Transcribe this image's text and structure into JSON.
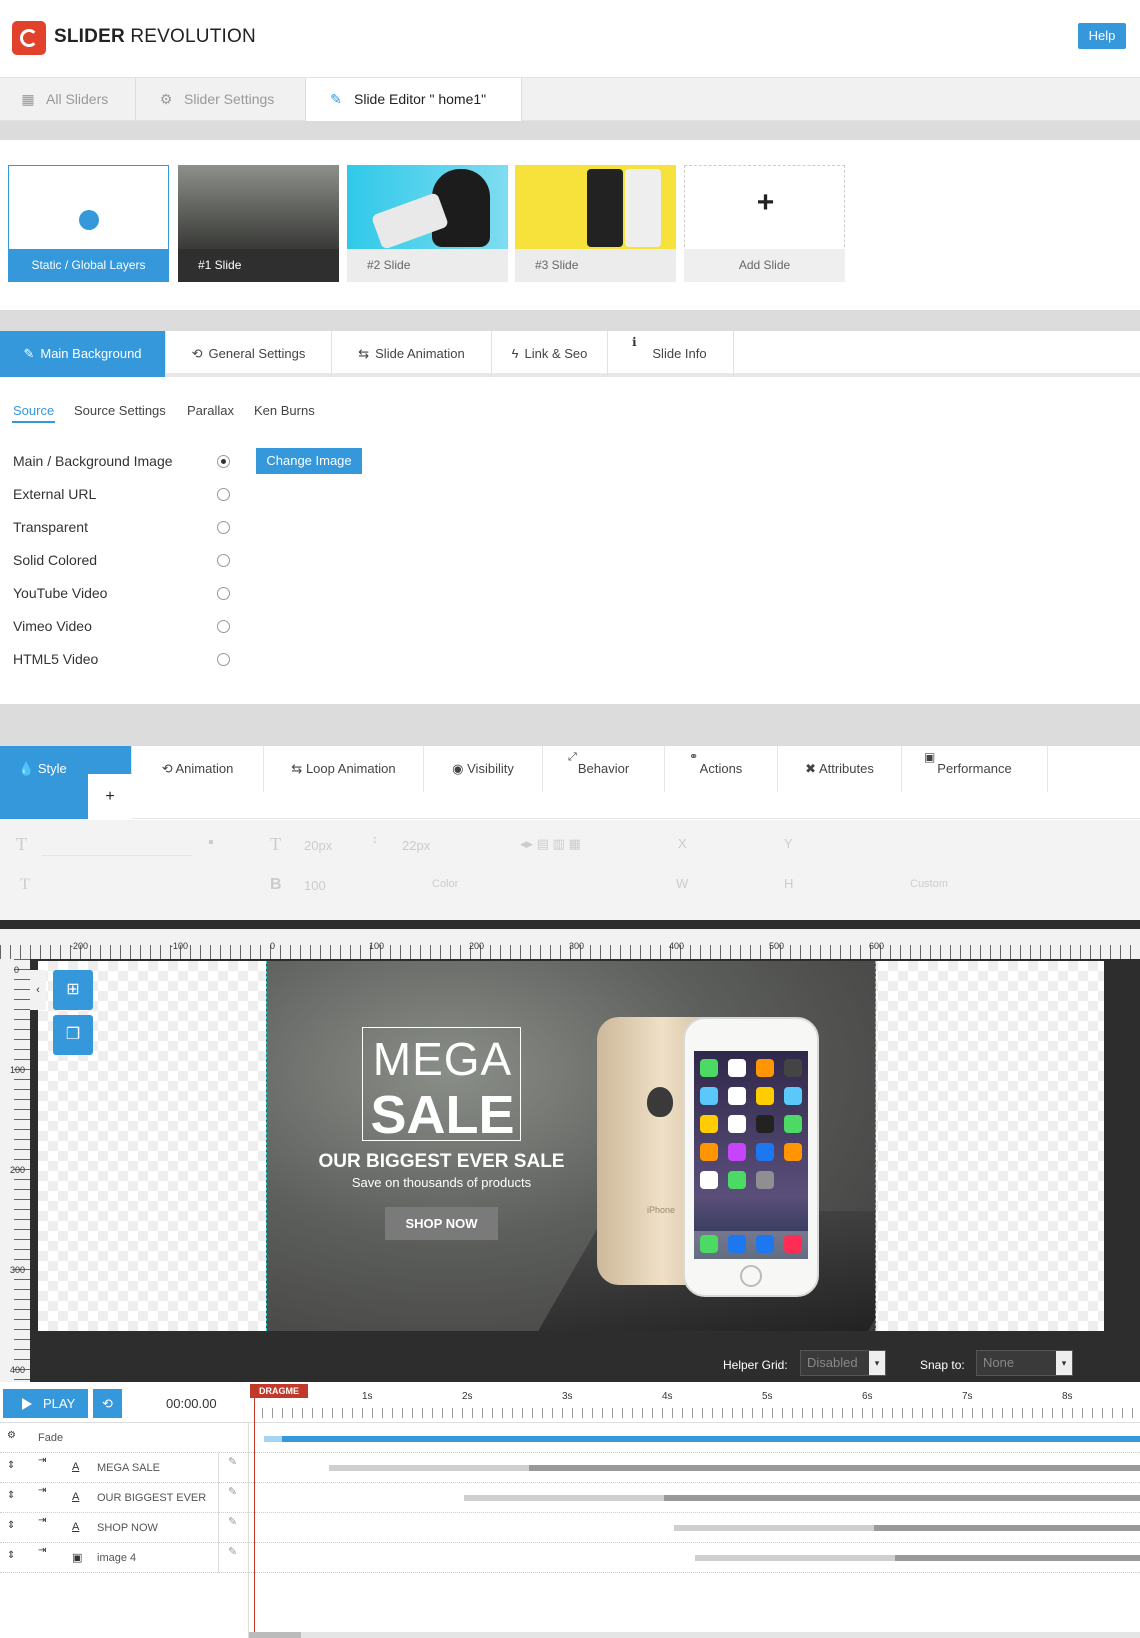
{
  "app": {
    "logo_bold": "SLIDER",
    "logo_rest": " REVOLUTION",
    "help": "Help"
  },
  "main_tabs": [
    {
      "label": "All Sliders",
      "icon": "grid-icon"
    },
    {
      "label": "Slider Settings",
      "icon": "gear-icon"
    },
    {
      "label": "Slide Editor \" home1\"",
      "icon": "pencil-icon"
    }
  ],
  "slides": [
    {
      "label": "Static / Global Layers"
    },
    {
      "label": "#1 Slide"
    },
    {
      "label": "#2 Slide"
    },
    {
      "label": "#3 Slide"
    },
    {
      "label": "Add Slide"
    }
  ],
  "slide_tabs": [
    "Main Background",
    "General Settings",
    "Slide Animation",
    "Link & Seo",
    "Slide Info"
  ],
  "sub_tabs": [
    "Source",
    "Source Settings",
    "Parallax",
    "Ken Burns"
  ],
  "sources": [
    {
      "label": "Main / Background Image",
      "selected": true
    },
    {
      "label": "External URL",
      "selected": false
    },
    {
      "label": "Transparent",
      "selected": false
    },
    {
      "label": "Solid Colored",
      "selected": false
    },
    {
      "label": "YouTube Video",
      "selected": false
    },
    {
      "label": "Vimeo Video",
      "selected": false
    },
    {
      "label": "HTML5 Video",
      "selected": false
    }
  ],
  "change_image": "Change Image",
  "layer_tabs": [
    "Style",
    "Animation",
    "Loop Animation",
    "Visibility",
    "Behavior",
    "Actions",
    "Attributes",
    "Performance"
  ],
  "toolbar": {
    "font_size": "20px",
    "line_height": "22px",
    "weight": "100",
    "color": "Color",
    "x": "X",
    "y": "Y",
    "w": "W",
    "h": "H",
    "custom": "Custom"
  },
  "rulers": {
    "h": [
      "-200",
      "-100",
      "0",
      "100",
      "200",
      "300",
      "400",
      "500",
      "600"
    ],
    "v": [
      "0",
      "100",
      "200",
      "300",
      "400"
    ]
  },
  "slide_content": {
    "mega": "MEGA",
    "sale": "SALE",
    "headline": "OUR BIGGEST EVER SALE",
    "subline": "Save on thousands of products",
    "cta": "SHOP NOW",
    "phone_label": "iPhone"
  },
  "editor_footer": {
    "helper_label": "Helper Grid:",
    "helper_value": "Disabled",
    "snap_label": "Snap to:",
    "snap_value": "None"
  },
  "timeline": {
    "play": "PLAY",
    "time": "00:00.00",
    "dragme": "DRAGME",
    "ticks": [
      "1s",
      "2s",
      "3s",
      "4s",
      "5s",
      "6s",
      "7s",
      "8s"
    ],
    "header_row": "Fade",
    "layers": [
      {
        "name": "MEGA SALE",
        "type": "text"
      },
      {
        "name": "OUR BIGGEST EVER SALE",
        "type": "text"
      },
      {
        "name": "SHOP NOW",
        "type": "text"
      },
      {
        "name": "image 4",
        "type": "image"
      }
    ]
  },
  "colors": {
    "accent": "#3498db",
    "logo": "#e2412c",
    "dragme": "#c0392b"
  }
}
